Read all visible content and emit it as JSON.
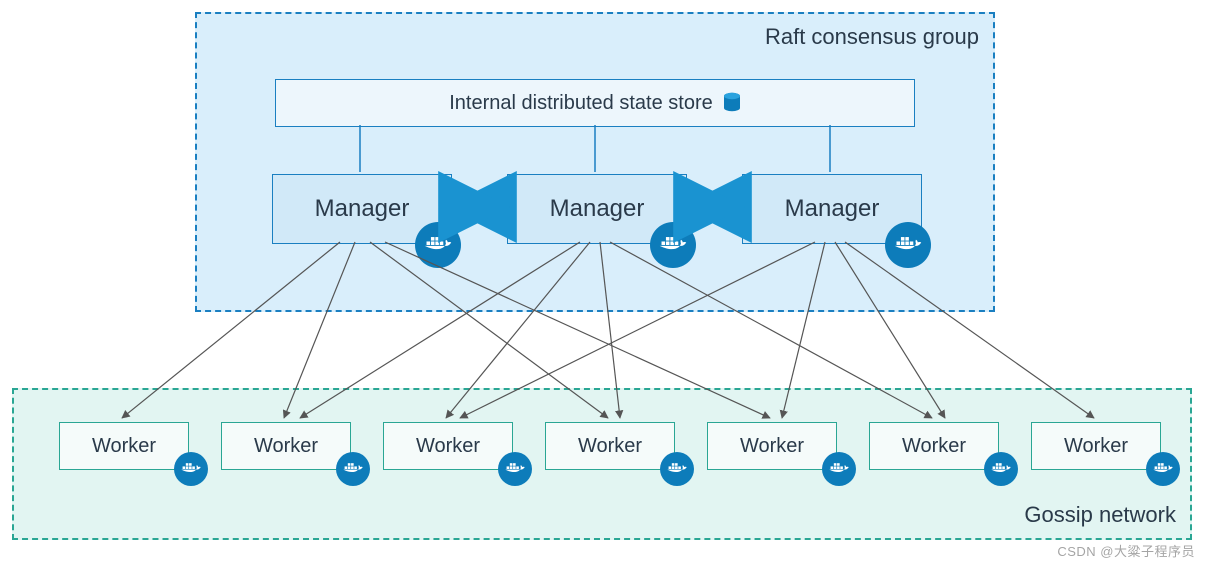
{
  "raft": {
    "group_label": "Raft consensus group",
    "state_store_label": "Internal distributed state store",
    "managers": [
      {
        "label": "Manager"
      },
      {
        "label": "Manager"
      },
      {
        "label": "Manager"
      }
    ]
  },
  "gossip": {
    "group_label": "Gossip network",
    "workers": [
      {
        "label": "Worker"
      },
      {
        "label": "Worker"
      },
      {
        "label": "Worker"
      },
      {
        "label": "Worker"
      },
      {
        "label": "Worker"
      },
      {
        "label": "Worker"
      },
      {
        "label": "Worker"
      }
    ]
  },
  "colors": {
    "raft_border": "#1a7fc1",
    "raft_fill": "#d9eefb",
    "manager_fill": "#d1e9f8",
    "gossip_border": "#2aa694",
    "gossip_fill": "#e2f5f2",
    "worker_fill": "#f5fbfa",
    "docker_blue": "#0d7cba",
    "arrow_gray": "#555555",
    "link_blue": "#1a93d1"
  },
  "icons": {
    "database": "database-icon",
    "docker": "docker-whale-icon"
  },
  "watermark": "CSDN @大粱子程序员"
}
